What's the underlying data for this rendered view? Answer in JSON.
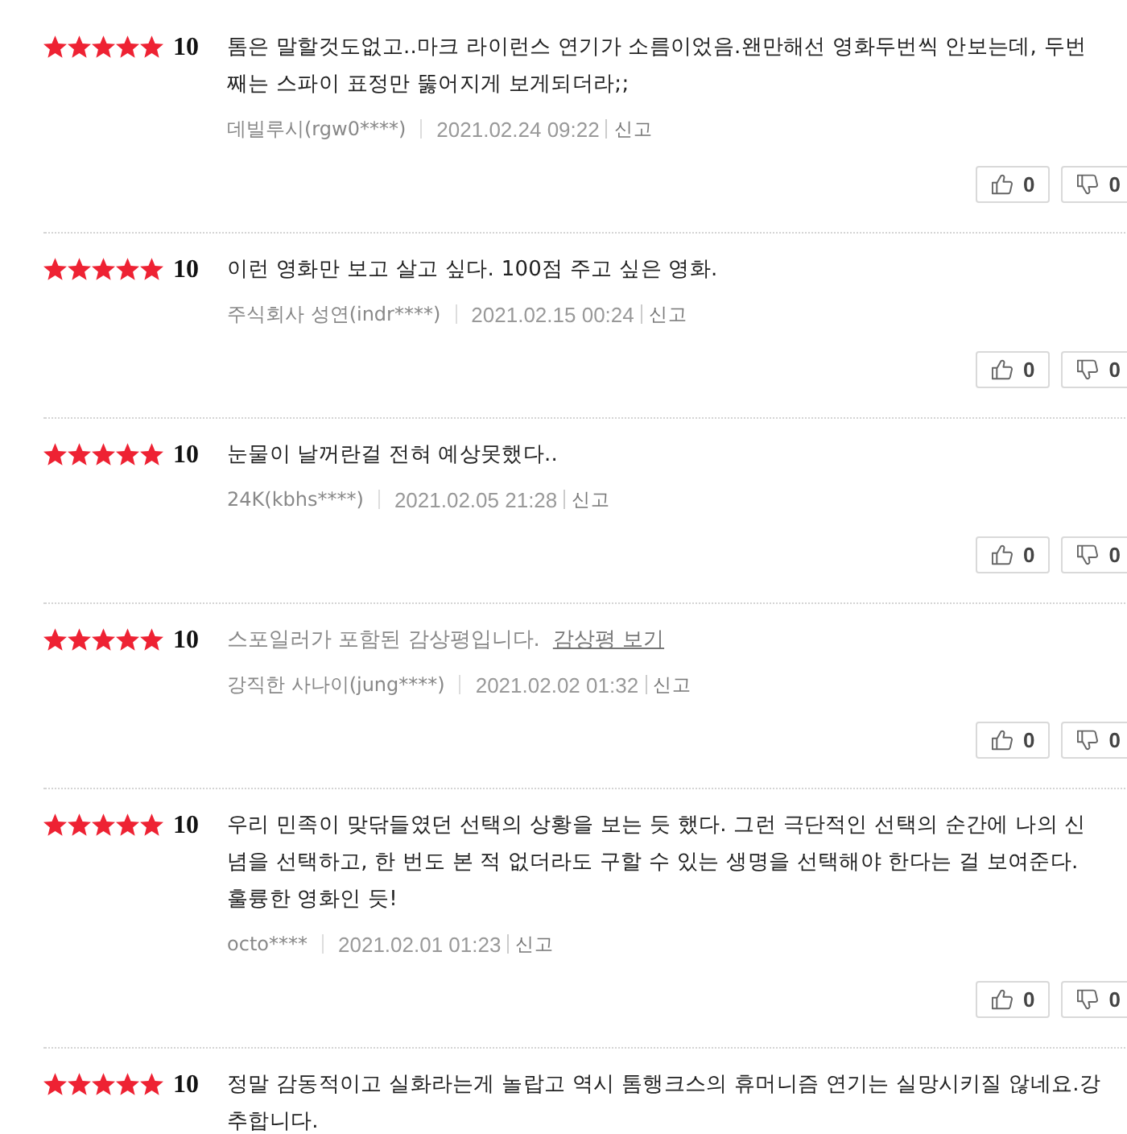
{
  "reviews": [
    {
      "kind": "text",
      "stars": 5,
      "score": "10",
      "text": "톰은 말할것도없고..마크 라이런스 연기가 소름이었음.왠만해선 영화두번씩 안보는데, 두번째는 스파이 표정만 뚫어지게 보게되더라;;",
      "author": "데빌루시(rgw0****)",
      "date": "2021.02.24 09:22",
      "report": "신고",
      "likes": "0",
      "dislikes": "0"
    },
    {
      "kind": "text",
      "stars": 5,
      "score": "10",
      "text": "이런 영화만 보고 살고 싶다. 100점 주고 싶은 영화.",
      "author": "주식회사 성연(indr****)",
      "date": "2021.02.15 00:24",
      "report": "신고",
      "likes": "0",
      "dislikes": "0"
    },
    {
      "kind": "text",
      "stars": 5,
      "score": "10",
      "text": "눈물이 날꺼란걸 전혀 예상못했다..",
      "author": "24K(kbhs****)",
      "date": "2021.02.05 21:28",
      "report": "신고",
      "likes": "0",
      "dislikes": "0"
    },
    {
      "kind": "spoiler",
      "stars": 5,
      "score": "10",
      "notice": "스포일러가 포함된 감상평입니다.",
      "link": "감상평 보기",
      "author": "강직한 사나이(jung****)",
      "date": "2021.02.02 01:32",
      "report": "신고",
      "likes": "0",
      "dislikes": "0"
    },
    {
      "kind": "text",
      "stars": 5,
      "score": "10",
      "text": "우리 민족이 맞닦들였던 선택의 상황을 보는 듯 했다. 그런 극단적인 선택의 순간에 나의 신념을 선택하고, 한 번도 본 적 없더라도 구할 수 있는 생명을 선택해야 한다는 걸 보여준다. 훌륭한 영화인 듯!",
      "author": "octo****",
      "date": "2021.02.01 01:23",
      "report": "신고",
      "likes": "0",
      "dislikes": "0"
    },
    {
      "kind": "text",
      "stars": 5,
      "score": "10",
      "text": "정말 감동적이고 실화라는게 놀랍고 역시 톰행크스의 휴머니즘 연기는 실망시키질 않네요.강추합니다."
    }
  ]
}
